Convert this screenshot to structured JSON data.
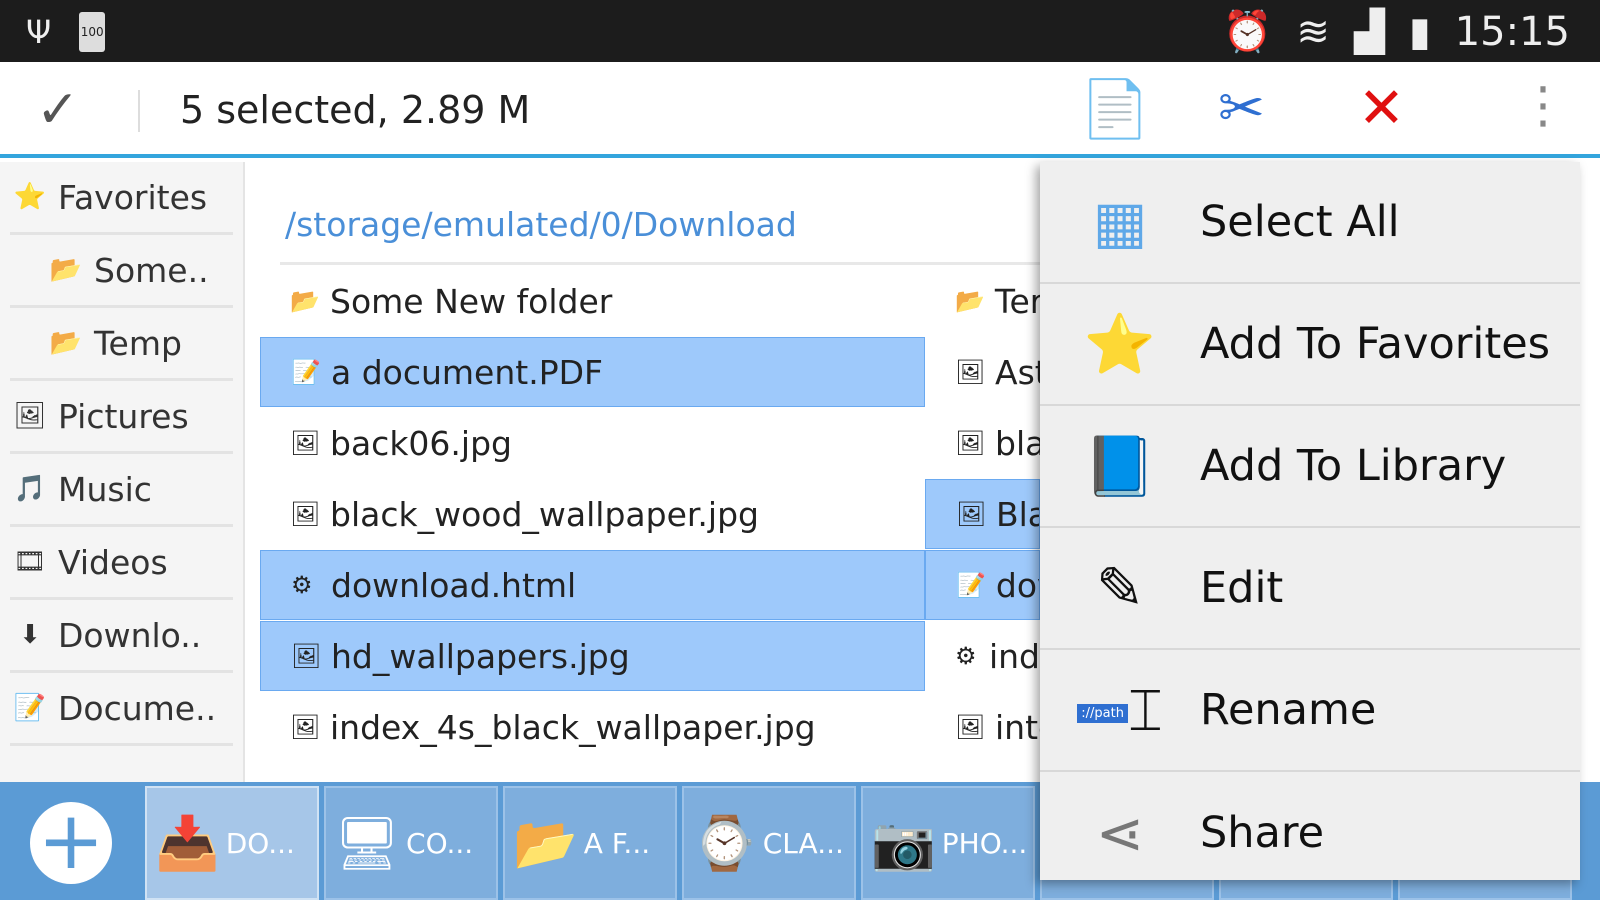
{
  "status_bar": {
    "battery": "100",
    "time": "15:15"
  },
  "action_bar": {
    "selection": "5 selected, 2.89 M"
  },
  "sidebar": {
    "items": [
      {
        "label": "Favorites",
        "icon": "star-icon",
        "sub": false
      },
      {
        "label": "Some..",
        "icon": "folder-icon",
        "sub": true
      },
      {
        "label": "Temp",
        "icon": "folder-icon",
        "sub": true
      },
      {
        "label": "Pictures",
        "icon": "pictures-icon",
        "sub": false
      },
      {
        "label": "Music",
        "icon": "music-icon",
        "sub": false
      },
      {
        "label": "Videos",
        "icon": "videos-icon",
        "sub": false
      },
      {
        "label": "Downlo..",
        "icon": "download-icon",
        "sub": false
      },
      {
        "label": "Docume..",
        "icon": "documents-icon",
        "sub": false
      }
    ]
  },
  "path": "/storage/emulated/0/Download",
  "files_col1": [
    {
      "name": "Some New folder",
      "icon": "folder-icon",
      "selected": false
    },
    {
      "name": "a document.PDF",
      "icon": "document-icon",
      "selected": true
    },
    {
      "name": "back06.jpg",
      "icon": "image-icon",
      "selected": false
    },
    {
      "name": "black_wood_wallpaper.jpg",
      "icon": "image-icon",
      "selected": false
    },
    {
      "name": "download.html",
      "icon": "gear-icon",
      "selected": true
    },
    {
      "name": "hd_wallpapers.jpg",
      "icon": "image-icon",
      "selected": true
    },
    {
      "name": "index_4s_black_wallpaper.jpg",
      "icon": "image-icon",
      "selected": false
    }
  ],
  "files_col2": [
    {
      "name": "Ter",
      "icon": "folder-icon",
      "selected": false
    },
    {
      "name": "Ast",
      "icon": "image-icon",
      "selected": false
    },
    {
      "name": "bla",
      "icon": "image-icon",
      "selected": false
    },
    {
      "name": "Bla",
      "icon": "image-icon",
      "selected": true
    },
    {
      "name": "dov",
      "icon": "document-icon",
      "selected": true
    },
    {
      "name": "ind",
      "icon": "gear-icon",
      "selected": false
    },
    {
      "name": "inte",
      "icon": "image-icon",
      "selected": false
    }
  ],
  "bottom_tabs": [
    {
      "label": "DO...",
      "icon": "download-folder-icon",
      "active": true
    },
    {
      "label": "CO...",
      "icon": "computer-icon",
      "active": false
    },
    {
      "label": "A F...",
      "icon": "folder-icon",
      "active": false
    },
    {
      "label": "CLA...",
      "icon": "watch-icon",
      "active": false
    },
    {
      "label": "PHO...",
      "icon": "camera-icon",
      "active": false
    }
  ],
  "menu": [
    {
      "label": "Select All",
      "icon": "select-all-icon"
    },
    {
      "label": "Add To Favorites",
      "icon": "star-icon"
    },
    {
      "label": "Add To Library",
      "icon": "library-add-icon"
    },
    {
      "label": "Edit",
      "icon": "pencil-icon"
    },
    {
      "label": "Rename",
      "icon": "rename-icon",
      "icon_text": "://path"
    },
    {
      "label": "Share",
      "icon": "share-icon"
    }
  ]
}
